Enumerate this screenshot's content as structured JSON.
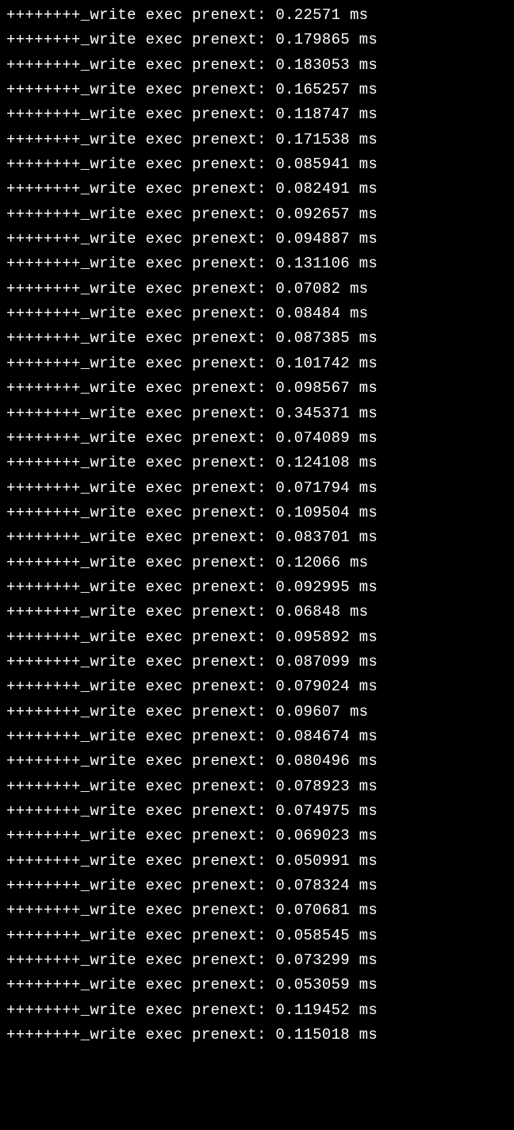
{
  "log": {
    "prefix": "++++++++_write exec prenext: ",
    "unit": "ms",
    "values": [
      "0.22571",
      "0.179865",
      "0.183053",
      "0.165257",
      "0.118747",
      "0.171538",
      "0.085941",
      "0.082491",
      "0.092657",
      "0.094887",
      "0.131106",
      "0.07082",
      "0.08484",
      "0.087385",
      "0.101742",
      "0.098567",
      "0.345371",
      "0.074089",
      "0.124108",
      "0.071794",
      "0.109504",
      "0.083701",
      "0.12066",
      "0.092995",
      "0.06848",
      "0.095892",
      "0.087099",
      "0.079024",
      "0.09607",
      "0.084674",
      "0.080496",
      "0.078923",
      "0.074975",
      "0.069023",
      "0.050991",
      "0.078324",
      "0.070681",
      "0.058545",
      "0.073299",
      "0.053059",
      "0.119452",
      "0.115018"
    ]
  }
}
